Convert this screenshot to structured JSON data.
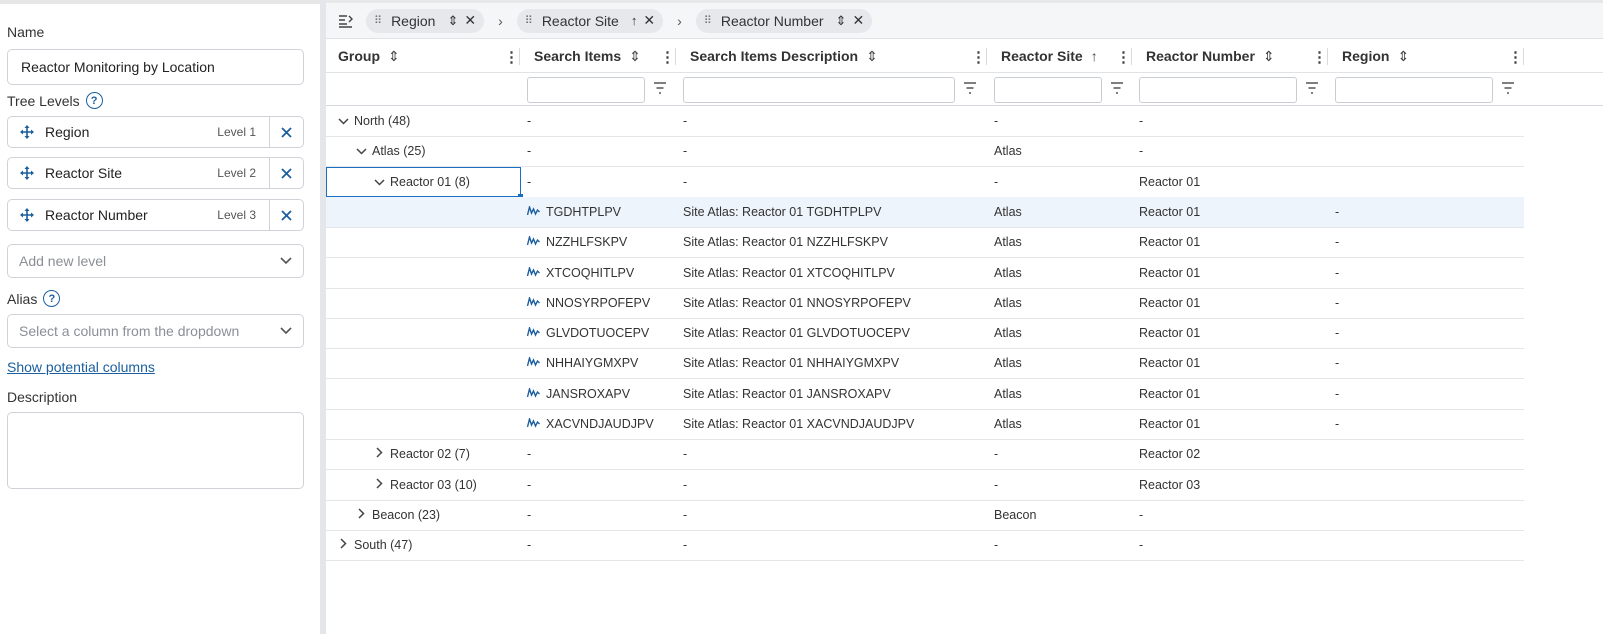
{
  "form": {
    "name_label": "Name",
    "name_value": "Reactor Monitoring by Location",
    "tree_levels_label": "Tree Levels",
    "help_glyph": "?",
    "levels": [
      {
        "name": "Region",
        "level": "Level 1"
      },
      {
        "name": "Reactor Site",
        "level": "Level 2"
      },
      {
        "name": "Reactor Number",
        "level": "Level 3"
      }
    ],
    "add_level_placeholder": "Add new level",
    "alias_label": "Alias",
    "alias_placeholder": "Select a column from the dropdown",
    "show_columns_link": "Show potential columns",
    "description_label": "Description",
    "description_value": ""
  },
  "row_group_bar": {
    "chips": [
      {
        "label": "Region",
        "sort": "none"
      },
      {
        "label": "Reactor Site",
        "sort": "asc"
      },
      {
        "label": "Reactor Number",
        "sort": "none"
      }
    ]
  },
  "grid": {
    "columns": [
      {
        "label": "Group",
        "sort": "none"
      },
      {
        "label": "Search Items",
        "sort": "none"
      },
      {
        "label": "Search Items Description",
        "sort": "none"
      },
      {
        "label": "Reactor Site",
        "sort": "asc"
      },
      {
        "label": "Reactor Number",
        "sort": "none"
      },
      {
        "label": "Region",
        "sort": "none"
      }
    ],
    "rows": [
      {
        "depth": 0,
        "toggle": "expanded",
        "group": "North (48)",
        "search": "-",
        "desc": "-",
        "site": "-",
        "number": "-",
        "region": ""
      },
      {
        "depth": 1,
        "toggle": "expanded",
        "group": "Atlas (25)",
        "search": "-",
        "desc": "-",
        "site": "Atlas",
        "number": "-",
        "region": ""
      },
      {
        "depth": 2,
        "toggle": "expanded",
        "group": "Reactor 01 (8)",
        "search": "-",
        "desc": "-",
        "site": "-",
        "number": "Reactor 01",
        "region": "",
        "focused": true
      },
      {
        "depth": 3,
        "leaf": true,
        "group": "",
        "search": "TGDHTPLPV",
        "desc": "Site Atlas: Reactor 01 TGDHTPLPV",
        "site": "Atlas",
        "number": "Reactor 01",
        "region": "-",
        "selected": true
      },
      {
        "depth": 3,
        "leaf": true,
        "group": "",
        "search": "NZZHLFSKPV",
        "desc": "Site Atlas: Reactor 01 NZZHLFSKPV",
        "site": "Atlas",
        "number": "Reactor 01",
        "region": "-"
      },
      {
        "depth": 3,
        "leaf": true,
        "group": "",
        "search": "XTCOQHITLPV",
        "desc": "Site Atlas: Reactor 01 XTCOQHITLPV",
        "site": "Atlas",
        "number": "Reactor 01",
        "region": "-"
      },
      {
        "depth": 3,
        "leaf": true,
        "group": "",
        "search": "NNOSYRPOFEPV",
        "desc": "Site Atlas: Reactor 01 NNOSYRPOFEPV",
        "site": "Atlas",
        "number": "Reactor 01",
        "region": "-"
      },
      {
        "depth": 3,
        "leaf": true,
        "group": "",
        "search": "GLVDOTUOCEPV",
        "desc": "Site Atlas: Reactor 01 GLVDOTUOCEPV",
        "site": "Atlas",
        "number": "Reactor 01",
        "region": "-"
      },
      {
        "depth": 3,
        "leaf": true,
        "group": "",
        "search": "NHHAIYGMXPV",
        "desc": "Site Atlas: Reactor 01 NHHAIYGMXPV",
        "site": "Atlas",
        "number": "Reactor 01",
        "region": "-"
      },
      {
        "depth": 3,
        "leaf": true,
        "group": "",
        "search": "JANSROXAPV",
        "desc": "Site Atlas: Reactor 01 JANSROXAPV",
        "site": "Atlas",
        "number": "Reactor 01",
        "region": "-"
      },
      {
        "depth": 3,
        "leaf": true,
        "group": "",
        "search": "XACVNDJAUDJPV",
        "desc": "Site Atlas: Reactor 01 XACVNDJAUDJPV",
        "site": "Atlas",
        "number": "Reactor 01",
        "region": "-"
      },
      {
        "depth": 2,
        "toggle": "collapsed",
        "group": "Reactor 02 (7)",
        "search": "-",
        "desc": "-",
        "site": "-",
        "number": "Reactor 02",
        "region": ""
      },
      {
        "depth": 2,
        "toggle": "collapsed",
        "group": "Reactor 03 (10)",
        "search": "-",
        "desc": "-",
        "site": "-",
        "number": "Reactor 03",
        "region": ""
      },
      {
        "depth": 1,
        "toggle": "collapsed",
        "group": "Beacon (23)",
        "search": "-",
        "desc": "-",
        "site": "Beacon",
        "number": "-",
        "region": ""
      },
      {
        "depth": 0,
        "toggle": "collapsed",
        "group": "South (47)",
        "search": "-",
        "desc": "-",
        "site": "-",
        "number": "-",
        "region": ""
      }
    ]
  },
  "icons": {
    "move": "move-icon",
    "close": "close-icon",
    "chevron_down": "chevron-down-icon",
    "sparkline": "sparkline-icon",
    "filter": "filter-icon",
    "column_menu": "column-menu-icon",
    "row_group_panel": "row-group-panel-icon"
  },
  "colors": {
    "accent": "#1b5f9e",
    "focus": "#1b6fc2",
    "selected_row": "#eef4fb"
  }
}
